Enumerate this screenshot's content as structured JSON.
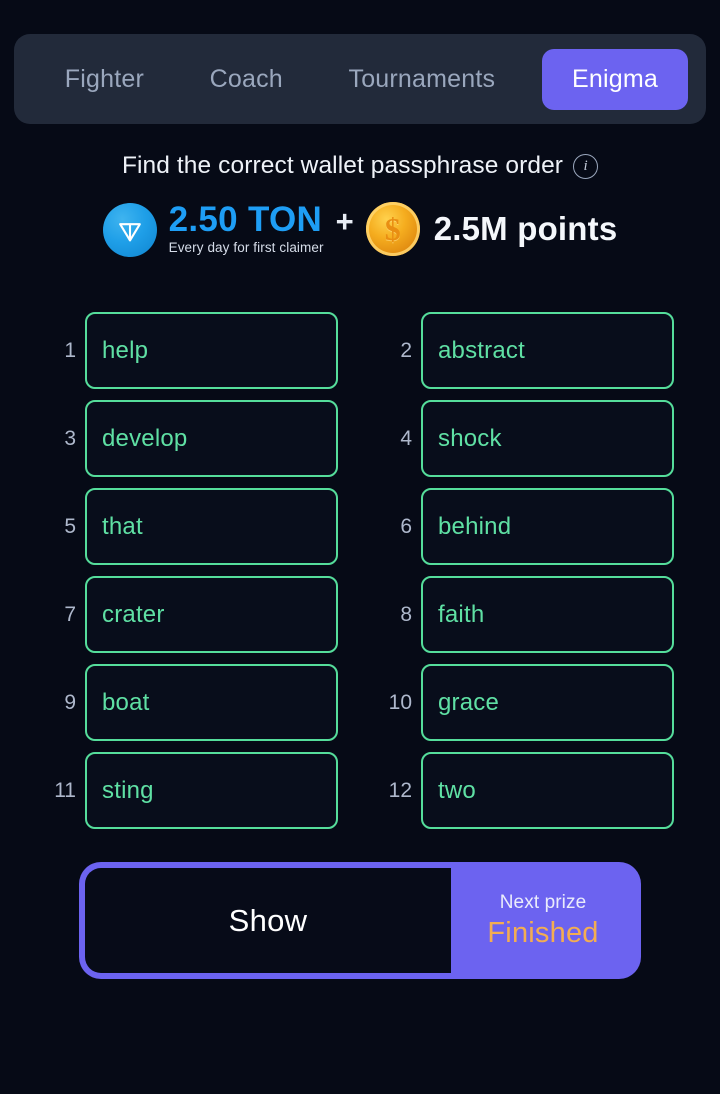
{
  "theme": {
    "page_bg": "#060a16",
    "tabbar_bg": "#222a3a",
    "accent_purple": "#6c63f0",
    "word_green": "#5fe0a4",
    "word_border_green": "#55dd9b",
    "ton_blue": "#1e9ef5",
    "finished_orange": "#f3ad52",
    "muted_text": "#9aa7bd"
  },
  "tabs": [
    {
      "label": "Fighter",
      "active": false
    },
    {
      "label": "Coach",
      "active": false
    },
    {
      "label": "Tournaments",
      "active": false
    },
    {
      "label": "Enigma",
      "active": true
    }
  ],
  "header": {
    "title": "Find the correct wallet passphrase order",
    "info_icon": "info-icon",
    "info_glyph": "i"
  },
  "prize": {
    "ton_icon": "ton-logo-icon",
    "ton_amount": "2.50 TON",
    "ton_subtitle": "Every day for first claimer",
    "separator": "+",
    "coin_icon": "dollar-coin-icon",
    "coin_glyph": "$",
    "points_amount": "2.5M points"
  },
  "passphrase": {
    "words": [
      {
        "index": "1",
        "word": "help"
      },
      {
        "index": "2",
        "word": "abstract"
      },
      {
        "index": "3",
        "word": "develop"
      },
      {
        "index": "4",
        "word": "shock"
      },
      {
        "index": "5",
        "word": "that"
      },
      {
        "index": "6",
        "word": "behind"
      },
      {
        "index": "7",
        "word": "crater"
      },
      {
        "index": "8",
        "word": "faith"
      },
      {
        "index": "9",
        "word": "boat"
      },
      {
        "index": "10",
        "word": "grace"
      },
      {
        "index": "11",
        "word": "sting"
      },
      {
        "index": "12",
        "word": "two"
      }
    ]
  },
  "actions": {
    "show_label": "Show",
    "next_prize_label": "Next prize",
    "next_prize_value": "Finished"
  }
}
